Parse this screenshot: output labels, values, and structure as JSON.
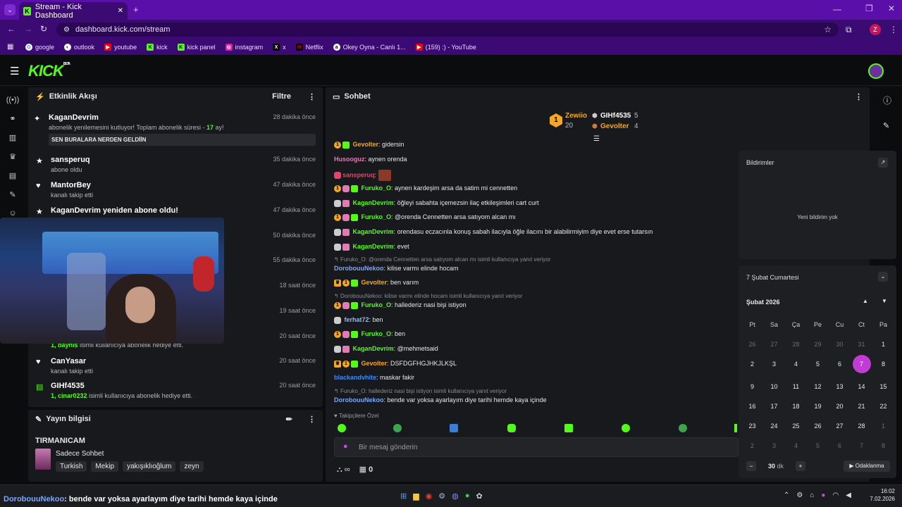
{
  "browser": {
    "tab_title": "Stream - Kick Dashboard",
    "url": "dashboard.kick.com/stream",
    "bookmarks": [
      "google",
      "outlook",
      "youtube",
      "kick",
      "kick panel",
      "instagram",
      "x",
      "Netflix",
      "Okey Oyna - Canlı 1...",
      "(159) :) - YouTube"
    ]
  },
  "kick": {
    "logo": "KICK",
    "beta": "BETA"
  },
  "activity": {
    "title": "Etkinlik Akışı",
    "filter": "Filtre",
    "events": [
      {
        "name": "KaganDevrim",
        "desc": "abonelik yenilemesini kutluyor! Toplam abonelik süresi - ",
        "months": "17",
        "desc_suffix": " ay!",
        "time": "28 dakika önce",
        "message": "SEN BURALARA NERDEN GELDİİN"
      },
      {
        "name": "sansperuq",
        "desc": "abone oldu",
        "time": "35 dakika önce"
      },
      {
        "name": "MantorBey",
        "desc": "kanalı takip etti",
        "time": "47 dakika önce"
      },
      {
        "name": "KaganDevrim yeniden abone oldu!",
        "desc": "",
        "time": "47 dakika önce"
      },
      {
        "time": "50 dakika önce"
      },
      {
        "time": "55 dakika önce"
      },
      {
        "time": "18 saat önce"
      },
      {
        "time": "19 saat önce"
      },
      {
        "time": "20 saat önce",
        "desc_prefix": "1, ",
        "who": "baynis",
        "desc": " isimli kullanıcıya abonelik hediye etti."
      },
      {
        "name": "CanYasar",
        "desc": "kanalı takip etti",
        "time": "20 saat önce"
      },
      {
        "name": "GIHf4535",
        "desc_prefix": "1, ",
        "who": "cinar0232",
        "desc": " isimli kullanıcıya abonelik hediye etti.",
        "time": "20 saat önce"
      }
    ]
  },
  "stream_info": {
    "title": "Yayın bilgisi",
    "stream_title": "TIRMANICAM",
    "category": "Sadece Sohbet",
    "tags": [
      "Turkish",
      "Mekip",
      "yakışıklıoğlum",
      "zeyn"
    ]
  },
  "chat": {
    "title": "Sohbet",
    "leaderboard": {
      "first_name": "Zewiio",
      "first_count": "20",
      "second_name": "GIHf4535",
      "second_count": "5",
      "third_name": "Gevolter",
      "third_count": "4"
    },
    "messages": [
      {
        "user": "Gevolter",
        "text": "gidersin",
        "color": "#f5a623"
      },
      {
        "user": "Husooguz",
        "text": "aynen orenda",
        "color": "#e07bb5"
      },
      {
        "user": "sansperuq",
        "text": "",
        "color": "#e0486b"
      },
      {
        "user": "Furuko_O",
        "text": "aynen kardeşim arsa da satim mi cennetten",
        "color": "#53fc18"
      },
      {
        "user": "KaganDevrim",
        "text": "öğleyi sabahta içemezsin ilaç etkileşimleri cart curt",
        "color": "#53fc18"
      },
      {
        "user": "Furuko_O",
        "text": "@orenda Cennetten arsa satıyom alcan mı",
        "color": "#53fc18"
      },
      {
        "user": "KaganDevrim",
        "text": "orendasu eczacınla konuş sabah ilacıyla öğle ilacını bir alabilirmiyim diye evet erse tutarsın",
        "color": "#53fc18"
      },
      {
        "user": "KaganDevrim",
        "text": "evet",
        "color": "#53fc18"
      },
      {
        "reply": "Furuko_O: @orenda Cennetten arsa satıyom alcan mı isimli kullanıcıya yanıt veriyor"
      },
      {
        "user": "DorobouuNekoo",
        "text": "kilise varmı elinde hocam",
        "color": "#7aa7ff"
      },
      {
        "user": "Gevolter",
        "text": "ben varım",
        "color": "#f5a623"
      },
      {
        "reply": "DorobouuNekoo: kilise varmı elinde hocam isimli kullanıcıya yanıt veriyor"
      },
      {
        "user": "Furuko_O",
        "text": "hallederiz nasi bişi istiyon",
        "color": "#53fc18"
      },
      {
        "user": "ferhat72",
        "text": "ben",
        "color": "#9ab7e8"
      },
      {
        "user": "Furuko_O",
        "text": "ben",
        "color": "#53fc18"
      },
      {
        "user": "KaganDevrim",
        "text": "@mehmetsaid",
        "color": "#53fc18"
      },
      {
        "user": "Gevolter",
        "text": "DSFDGFHGJHKJLKŞL",
        "color": "#f5a623"
      },
      {
        "user": "blackandvhite",
        "text": "maskar fakir",
        "color": "#3a8cff"
      },
      {
        "reply": "Furuko_O: hallederiz nasi bişi istiyon isimli kullanıcıya yanıt veriyor"
      },
      {
        "user": "DorobouuNekoo",
        "text": "bende var yoksa ayarlayım diye tarihi hemde kaya içinde",
        "color": "#7aa7ff"
      }
    ],
    "followers_only": "Takipçilere Özel",
    "input_placeholder": "Bir mesaj gönderin",
    "infinity": "∞",
    "store_count": "0"
  },
  "notifications": {
    "title": "Bildirimler",
    "empty": "Yeni bildirim yok"
  },
  "calendar": {
    "header": "7 Şubat Cumartesi",
    "month": "Şubat 2026",
    "weekdays": [
      "Pt",
      "Sa",
      "Ça",
      "Pe",
      "Cu",
      "Ct",
      "Pa"
    ],
    "days": [
      "26",
      "27",
      "28",
      "29",
      "30",
      "31",
      "1",
      "2",
      "3",
      "4",
      "5",
      "6",
      "7",
      "8",
      "9",
      "10",
      "11",
      "12",
      "13",
      "14",
      "15",
      "16",
      "17",
      "18",
      "19",
      "20",
      "21",
      "22",
      "23",
      "24",
      "25",
      "26",
      "27",
      "28",
      "1",
      "2",
      "3",
      "4",
      "5",
      "6",
      "7",
      "8"
    ],
    "selected": "7",
    "focus_minutes": "30",
    "focus_unit": "dk",
    "focus_label": "Odaklanma"
  },
  "overlay_message": {
    "user": "DorobouuNekoo",
    "text": ": bende var yoksa ayarlayım diye tarihi hemde kaya içinde"
  },
  "taskbar": {
    "time": "16:02",
    "date": "7.02.2026"
  },
  "avatar_initial": "Z"
}
